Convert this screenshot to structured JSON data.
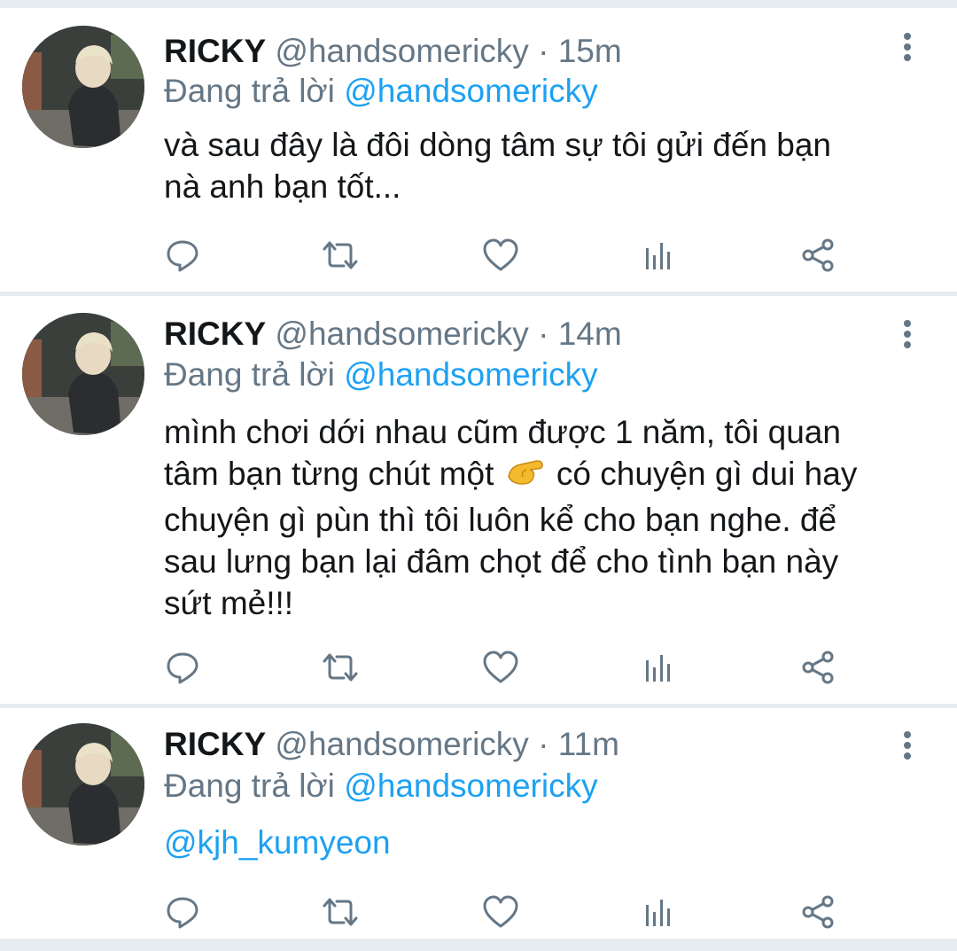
{
  "tweets": [
    {
      "name": "RICKY",
      "handle": "@handsomericky",
      "separator": "·",
      "time": "15m",
      "replying_label": "Đang trả lời",
      "replying_to": "@handsomericky",
      "lines": [
        "và sau đây là đôi dòng tâm sự tôi gửi đến bạn",
        "nà anh bạn tốt..."
      ]
    },
    {
      "name": "RICKY",
      "handle": "@handsomericky",
      "separator": "·",
      "time": "14m",
      "replying_label": "Đang trả lời",
      "replying_to": "@handsomericky",
      "lines": [
        "mình chơi dới nhau cũm được 1 năm, tôi quan",
        "tâm bạn từng chút một",
        "có chuyện gì dui hay",
        "chuyện gì pùn thì tôi luôn kể cho bạn nghe. để",
        "sau lưng bạn lại đâm chọt để cho tình bạn này",
        "sứt mẻ!!!"
      ],
      "emoji": "pinching-hand-emoji"
    },
    {
      "name": "RICKY",
      "handle": "@handsomericky",
      "separator": "·",
      "time": "11m",
      "replying_label": "Đang trả lời",
      "replying_to": "@handsomericky",
      "mention": "@kjh_kumyeon"
    }
  ],
  "actions": [
    "reply-icon",
    "retweet-icon",
    "like-icon",
    "analytics-icon",
    "share-icon"
  ],
  "colors": {
    "accent": "#1da1f2",
    "secondary_text": "#657786",
    "primary_text": "#14171a",
    "divider": "#e6ecf0"
  }
}
